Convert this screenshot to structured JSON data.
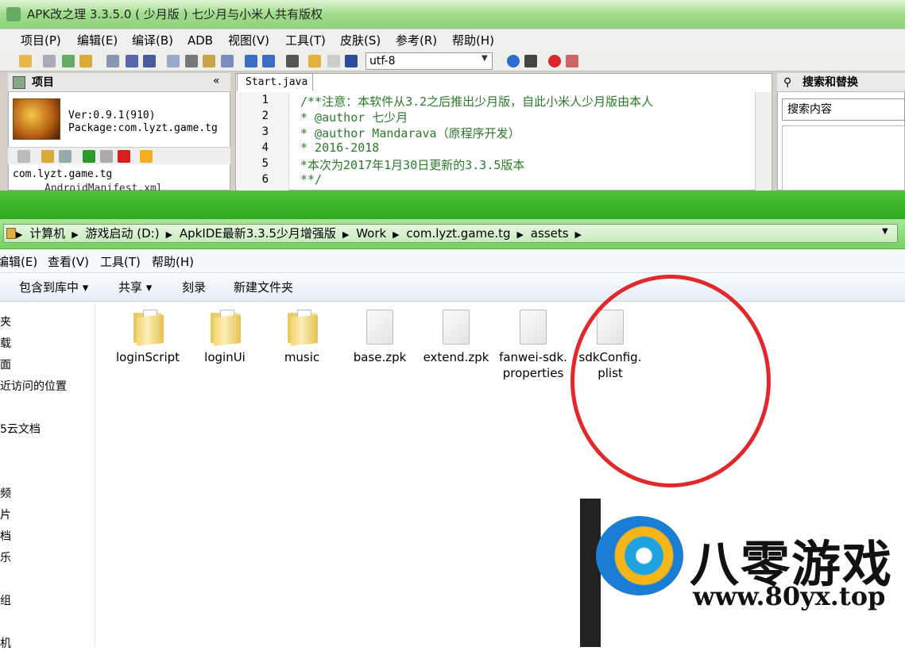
{
  "apk": {
    "title": "APK改之理 3.3.5.0 ( 少月版 ) 七少月与小米人共有版权",
    "menu": [
      "项目(P)",
      "编辑(E)",
      "编译(B)",
      "ADB",
      "视图(V)",
      "工具(T)",
      "皮肤(S)",
      "参考(R)",
      "帮助(H)"
    ],
    "encoding": "utf-8",
    "project_panel": {
      "title": "项目",
      "collapse": "«",
      "version": "Ver:0.9.1(910)",
      "package": "Package:com.lyzt.game.tg",
      "tree_root": "com.lyzt.game.tg",
      "tree_child": "AndroidManifest.xml"
    },
    "editor": {
      "tab": "Start.java",
      "line_numbers": [
        "1",
        "2",
        "3",
        "4",
        "5",
        "6"
      ],
      "lines": [
        "/**注意：本软件从3.2之后推出少月版，自此小米人少月版由本人",
        " * @author 七少月",
        " * @author Mandarava（原程序开发）",
        " * 2016-2018",
        " *本次为2017年1月30日更新的3.3.5版本",
        " **/"
      ]
    },
    "search_panel": {
      "title": "搜索和替换",
      "placeholder": "搜索内容"
    },
    "colors": {
      "title_bar": "#9fdc8a",
      "code_comment": "#2a7a2a"
    }
  },
  "explorer": {
    "breadcrumb": [
      "计算机",
      "游戏启动 (D:)",
      "ApkIDE最新3.3.5少月增强版",
      "Work",
      "com.lyzt.game.tg",
      "assets"
    ],
    "menu": [
      "编辑(E)",
      "查看(V)",
      "工具(T)",
      "帮助(H)"
    ],
    "commands": [
      "包含到库中 ▾",
      "共享 ▾",
      "刻录",
      "新建文件夹"
    ],
    "nav_items": [
      "夹",
      "载",
      "面",
      "近访问的位置",
      "5云文档",
      "频",
      "片",
      "档",
      "乐",
      "组",
      "机"
    ],
    "files": [
      {
        "name": "loginScript",
        "type": "folder"
      },
      {
        "name": "loginUi",
        "type": "folder"
      },
      {
        "name": "music",
        "type": "folder"
      },
      {
        "name": "base.zpk",
        "type": "file"
      },
      {
        "name": "extend.zpk",
        "type": "file"
      },
      {
        "name": "fanwei-sdk.properties",
        "type": "file"
      },
      {
        "name": "sdkConfig.plist",
        "type": "file"
      }
    ],
    "highlight_color": "#e3282c"
  },
  "watermark": {
    "title": "八零游戏",
    "url": "www.80yx.top"
  }
}
